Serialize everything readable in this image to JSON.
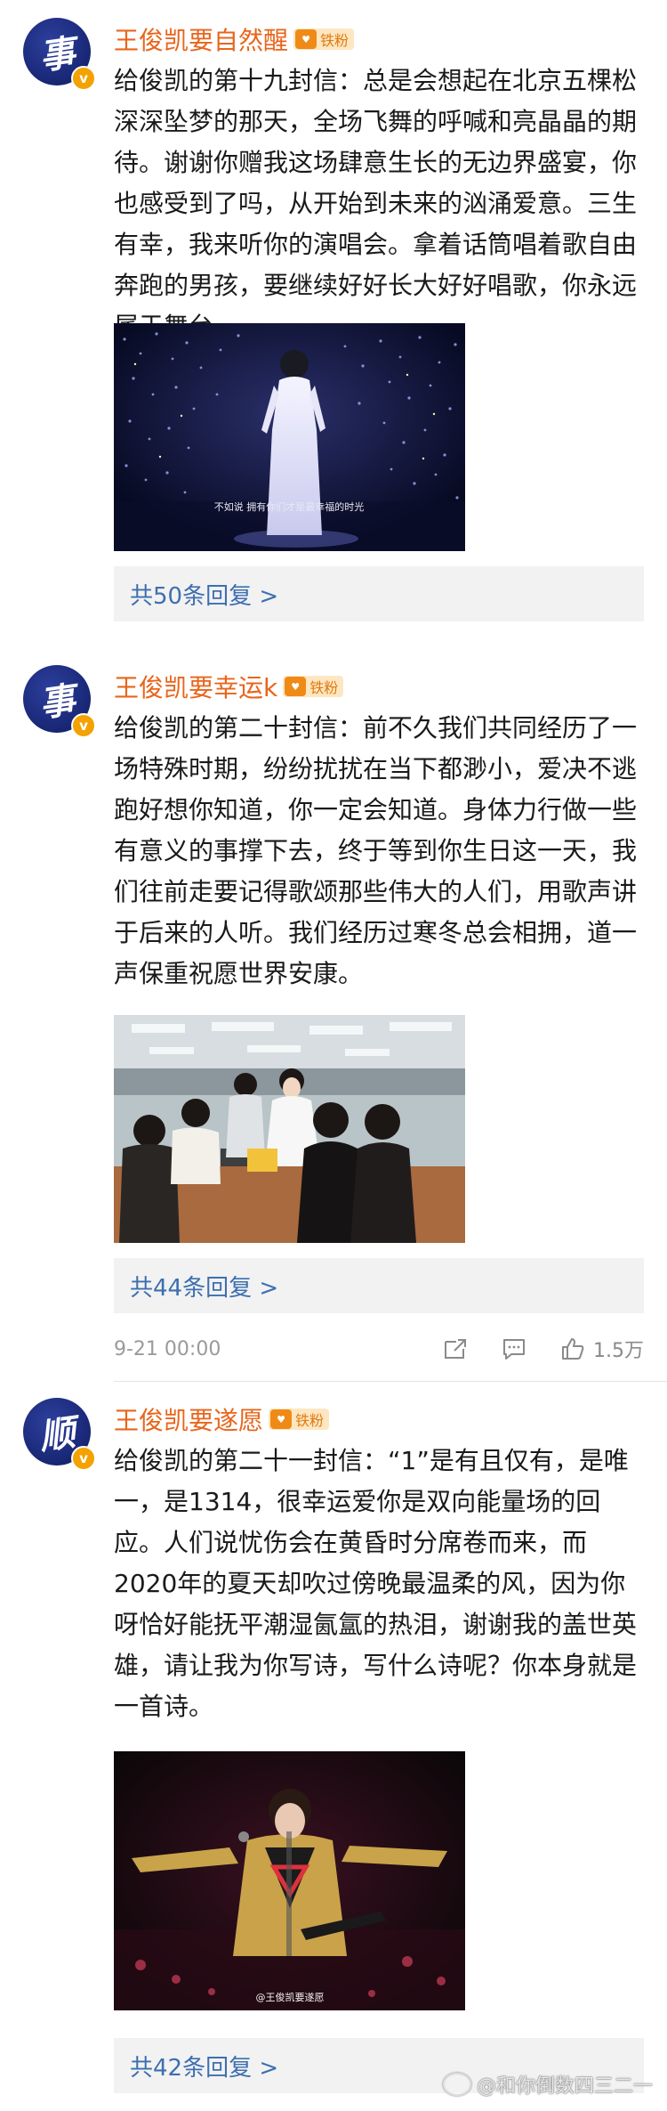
{
  "posts": [
    {
      "avatar_glyph": "事",
      "username": "王俊凯要自然醒",
      "fan_badge": "铁粉",
      "text": "给俊凯的第十九封信：总是会想起在北京五棵松深深坠梦的那天，全场飞舞的呼喊和亮晶晶的期待。谢谢你赠我这场肆意生长的无边界盛宴，你也感受到了吗，从开始到未来的汹涌爱意。三生有幸，我来听你的演唱会。拿着话筒唱着歌自由奔跑的男孩，要继续好好长大好好唱歌，你永远属于舞台",
      "photo_caption": "不如说 拥有你们才是最幸福的时光",
      "replies_label": "共50条回复 >"
    },
    {
      "avatar_glyph": "事",
      "username": "王俊凯要幸运k",
      "fan_badge": "铁粉",
      "text": "给俊凯的第二十封信：前不久我们共同经历了一场特殊时期，纷纷扰扰在当下都渺小，爱决不逃跑好想你知道，你一定会知道。身体力行做一些有意义的事撑下去，终于等到你生日这一天，我们往前走要记得歌颂那些伟大的人们，用歌声讲于后来的人听。我们经历过寒冬总会相拥，道一声保重祝愿世界安康。",
      "replies_label": "共44条回复 >"
    },
    {
      "avatar_glyph": "顺",
      "username": "王俊凯要遂愿",
      "fan_badge": "铁粉",
      "text": "给俊凯的第二十一封信：“1”是有且仅有，是唯一，是1314，很幸运爱你是双向能量场的回应。人们说忧伤会在黄昏时分席卷而来，而2020年的夏天却吹过傍晚最温柔的风，因为你呀恰好能抚平潮湿氤氲的热泪，谢谢我的盖世英雄，请让我为你写诗，写什么诗呢？你本身就是一首诗。",
      "photo_watermark": "@王俊凯要遂愿",
      "replies_label": "共42条回复 >"
    }
  ],
  "meta": {
    "time": "9-21 00:00",
    "likes": "1.5万"
  },
  "watermark": "@和你倒数四三二一",
  "icons": [
    "share-icon",
    "comment-icon",
    "like-icon",
    "verified-icon"
  ],
  "colors": {
    "username": "#e8651b",
    "link": "#3e6fb0",
    "reply_bg": "#f2f2f2",
    "avatar": "#1b2a7a"
  }
}
